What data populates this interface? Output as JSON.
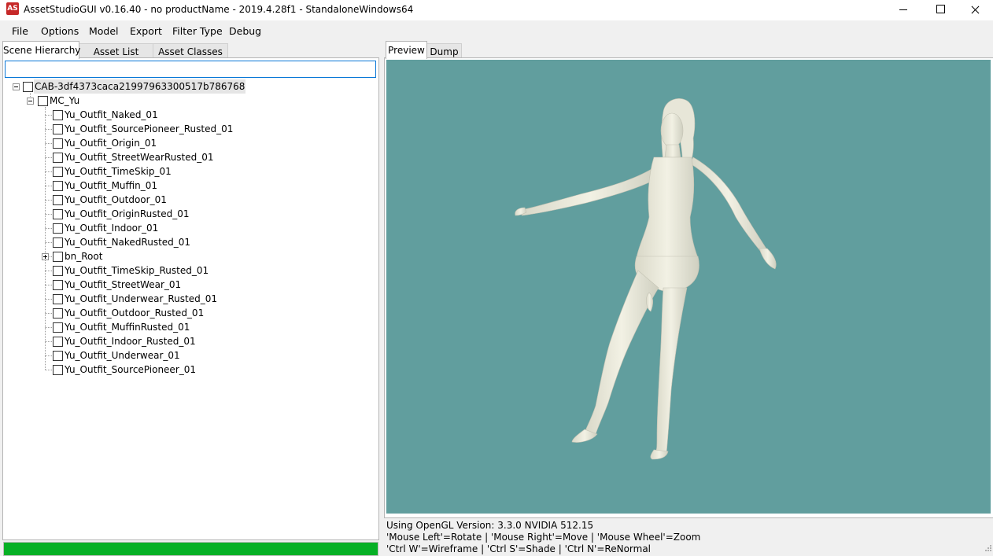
{
  "window": {
    "title": "AssetStudioGUI v0.16.40 - no productName - 2019.4.28f1 - StandaloneWindows64",
    "icon_text": "AS"
  },
  "menu": [
    "File",
    "Options",
    "Model",
    "Export",
    "Filter Type",
    "Debug"
  ],
  "left_tabs": [
    "Scene Hierarchy",
    "Asset List",
    "Asset Classes"
  ],
  "search": {
    "value": "",
    "placeholder": ""
  },
  "tree": {
    "root": "CAB-3df4373caca21997963300517b786768",
    "parent": "MC_Yu",
    "children": [
      "Yu_Outfit_Naked_01",
      "Yu_Outfit_SourcePioneer_Rusted_01",
      "Yu_Outfit_Origin_01",
      "Yu_Outfit_StreetWearRusted_01",
      "Yu_Outfit_TimeSkip_01",
      "Yu_Outfit_Muffin_01",
      "Yu_Outfit_Outdoor_01",
      "Yu_Outfit_OriginRusted_01",
      "Yu_Outfit_Indoor_01",
      "Yu_Outfit_NakedRusted_01",
      "bn_Root",
      "Yu_Outfit_TimeSkip_Rusted_01",
      "Yu_Outfit_StreetWear_01",
      "Yu_Outfit_Underwear_Rusted_01",
      "Yu_Outfit_Outdoor_Rusted_01",
      "Yu_Outfit_MuffinRusted_01",
      "Yu_Outfit_Indoor_Rusted_01",
      "Yu_Outfit_Underwear_01",
      "Yu_Outfit_SourcePioneer_01"
    ]
  },
  "progress": {
    "fraction": 1.0,
    "color": "#06b025"
  },
  "right_tabs": [
    "Preview",
    "Dump"
  ],
  "preview": {
    "background": "#619e9e"
  },
  "status": [
    "Using OpenGL Version: 3.3.0 NVIDIA 512.15",
    "'Mouse Left'=Rotate | 'Mouse Right'=Move | 'Mouse Wheel'=Zoom",
    "'Ctrl W'=Wireframe | 'Ctrl S'=Shade | 'Ctrl N'=ReNormal"
  ]
}
